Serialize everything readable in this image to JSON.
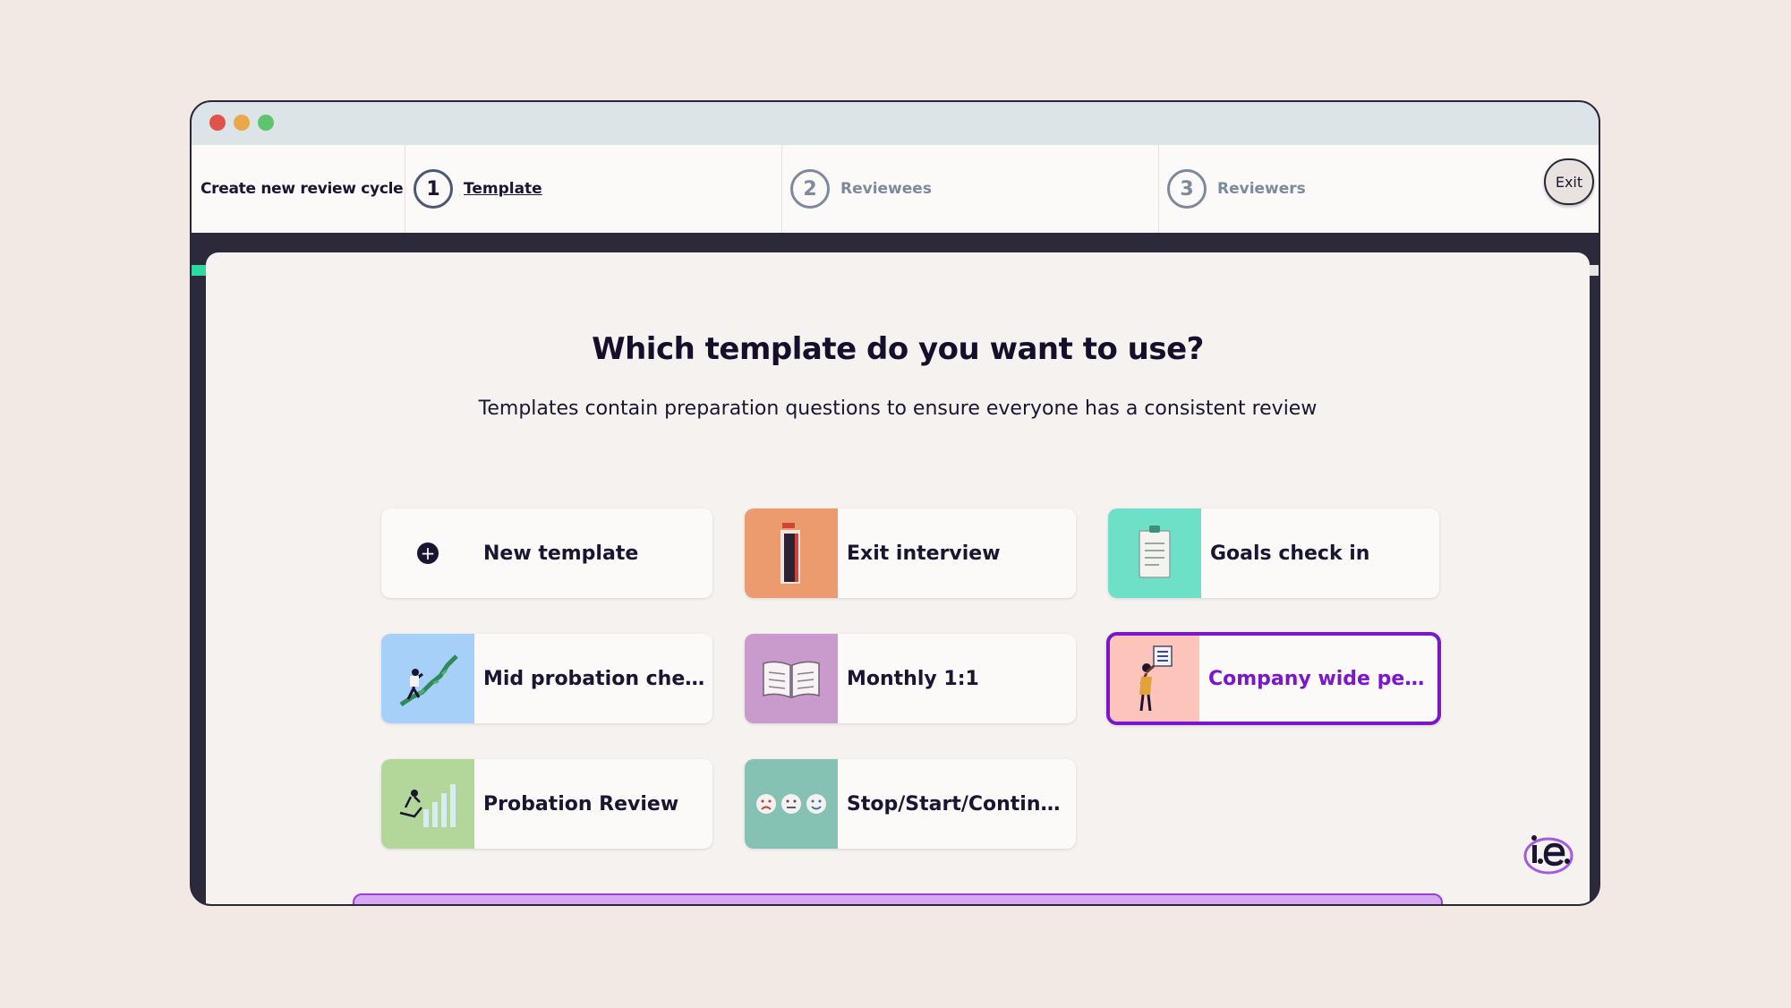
{
  "header": {
    "title": "Create new review cycle",
    "steps": [
      {
        "number": "1",
        "label": "Template"
      },
      {
        "number": "2",
        "label": "Reviewees"
      },
      {
        "number": "3",
        "label": "Reviewers"
      }
    ],
    "exit_label": "Exit",
    "progress_fraction": 0.285
  },
  "main": {
    "heading": "Which template do you want to use?",
    "subheading": "Templates contain preparation questions to ensure everyone has a consistent review",
    "templates": [
      {
        "label": "New template",
        "icon": "plus-icon",
        "thumb_color": "#fbfaf9"
      },
      {
        "label": "Exit interview",
        "icon": "door-icon",
        "thumb_color": "#ec9b6e"
      },
      {
        "label": "Goals check in",
        "icon": "clipboard-icon",
        "thumb_color": "#6fe0c8"
      },
      {
        "label": "Mid probation check...",
        "icon": "climbing-person-icon",
        "thumb_color": "#a6d0f7"
      },
      {
        "label": "Monthly 1:1",
        "icon": "open-book-icon",
        "thumb_color": "#c99bcc"
      },
      {
        "label": "Company wide perf...",
        "icon": "person-with-chart-icon",
        "thumb_color": "#fcc4bb",
        "selected": true
      },
      {
        "label": "Probation Review",
        "icon": "growth-chart-icon",
        "thumb_color": "#b3d69b"
      },
      {
        "label": "Stop/Start/Continue...",
        "icon": "faces-icon",
        "thumb_color": "#85c2b4"
      }
    ]
  },
  "colors": {
    "accent": "#7b16c9",
    "progress": "#2fd8a0",
    "banner": "#d9a8f5"
  },
  "logo": {
    "icon": "ie-logo-icon"
  }
}
